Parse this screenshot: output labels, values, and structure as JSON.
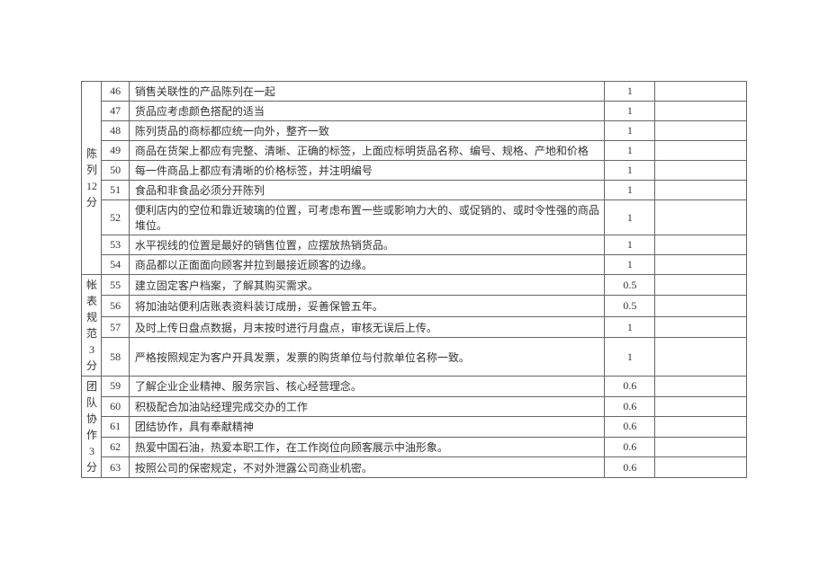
{
  "groups": [
    {
      "category": "陈列12分",
      "rows": [
        {
          "num": "46",
          "desc": "销售关联性的产品陈列在一起",
          "score": "1"
        },
        {
          "num": "47",
          "desc": "货品应考虑颜色搭配的适当",
          "score": "1"
        },
        {
          "num": "48",
          "desc": "陈列货品的商标都应统一向外，整齐一致",
          "score": "1"
        },
        {
          "num": "49",
          "desc": "商品在货架上都应有完整、清晰、正确的标签，上面应标明货品名称、编号、规格、产地和价格",
          "score": "1"
        },
        {
          "num": "50",
          "desc": "每一件商品上都应有清晰的价格标签，并注明编号",
          "score": "1"
        },
        {
          "num": "51",
          "desc": "食品和非食品必须分开陈列",
          "score": "1"
        },
        {
          "num": "52",
          "desc": "便利店内的空位和靠近玻璃的位置，可考虑布置一些或影响力大的、或促销的、或时令性强的商品堆位。",
          "score": "1"
        },
        {
          "num": "53",
          "desc": "水平视线的位置是最好的销售位置，应摆放热销货品。",
          "score": "1"
        },
        {
          "num": "54",
          "desc": "商品都以正面面向顾客并拉到最接近顾客的边缘。",
          "score": "1"
        }
      ]
    },
    {
      "category": "帐表规范3分",
      "rows": [
        {
          "num": "55",
          "desc": "建立固定客户档案，了解其购买需求。",
          "score": "0.5"
        },
        {
          "num": "56",
          "desc": "将加油站便利店账表资料装订成册，妥善保管五年。",
          "score": "0.5"
        },
        {
          "num": "57",
          "desc": "及时上传日盘点数据，月末按时进行月盘点，审核无误后上传。",
          "score": "1"
        },
        {
          "num": "58",
          "desc": "严格按照规定为客户开具发票，发票的购货单位与付款单位名称一致。",
          "score": "1",
          "tall": true
        }
      ]
    },
    {
      "category": "团队协作3分",
      "rows": [
        {
          "num": "59",
          "desc": "了解企业企业精神、服务宗旨、核心经营理念。",
          "score": "0.6"
        },
        {
          "num": "60",
          "desc": "积极配合加油站经理完成交办的工作",
          "score": "0.6"
        },
        {
          "num": "61",
          "desc": "团结协作，具有奉献精神",
          "score": "0.6"
        },
        {
          "num": "62",
          "desc": "热爱中国石油，热爱本职工作，在工作岗位向顾客展示中油形象。",
          "score": "0.6"
        },
        {
          "num": "63",
          "desc": "按照公司的保密规定，不对外泄露公司商业机密。",
          "score": "0.6"
        }
      ]
    }
  ]
}
